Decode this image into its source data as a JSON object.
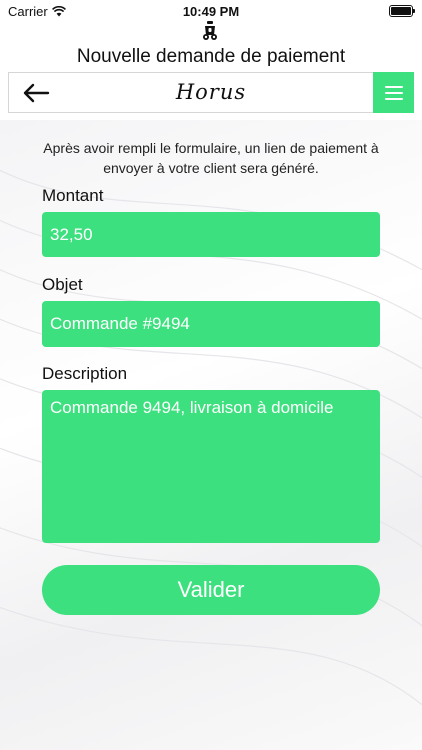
{
  "status_bar": {
    "carrier": "Carrier",
    "time": "10:49 PM"
  },
  "header": {
    "title": "Nouvelle demande de paiement",
    "brand": "Horus"
  },
  "form": {
    "intro": "Après avoir rempli le formulaire, un lien de paiement à envoyer à votre client sera généré.",
    "amount_label": "Montant",
    "amount_value": "32,50",
    "object_label": "Objet",
    "object_value": "Commande #9494",
    "description_label": "Description",
    "description_value": "Commande 9494, livraison à domicile",
    "submit_label": "Valider"
  },
  "icons": {
    "top": "scooter-icon",
    "back": "arrow-left-icon",
    "menu": "hamburger-menu-icon",
    "wifi": "wifi-icon",
    "battery": "battery-icon"
  },
  "colors": {
    "accent": "#3de07e",
    "text": "#111111",
    "on_accent": "#ffffff"
  }
}
